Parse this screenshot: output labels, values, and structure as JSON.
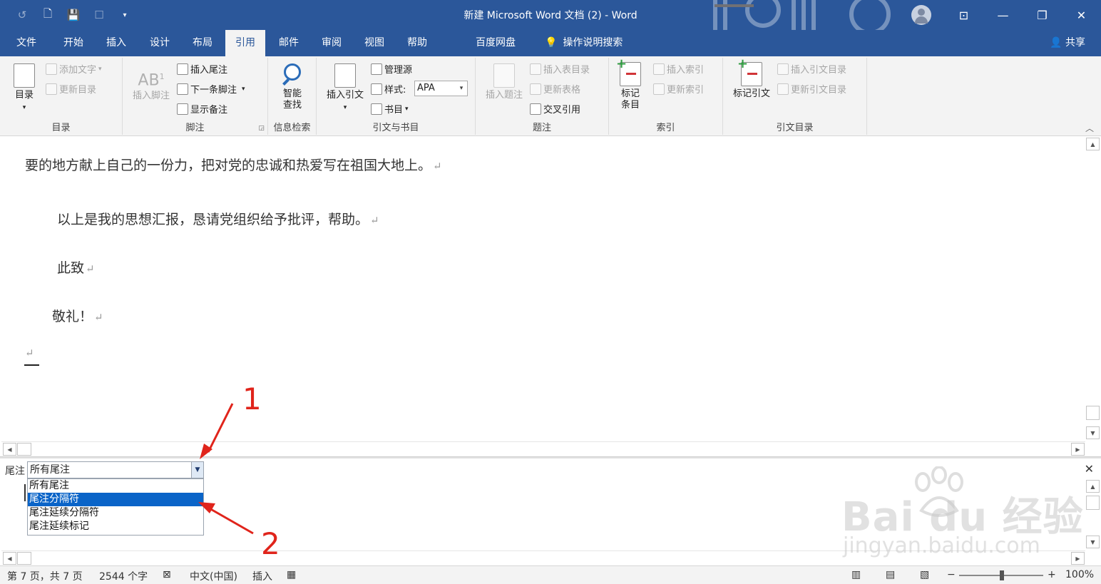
{
  "window": {
    "title": "新建 Microsoft Word 文档 (2)  -  Word",
    "controls": [
      "⊡",
      "—",
      "❐",
      "✕"
    ]
  },
  "tabs": [
    {
      "label": "文件"
    },
    {
      "label": "开始"
    },
    {
      "label": "插入"
    },
    {
      "label": "设计"
    },
    {
      "label": "布局"
    },
    {
      "label": "引用"
    },
    {
      "label": "邮件"
    },
    {
      "label": "审阅"
    },
    {
      "label": "视图"
    },
    {
      "label": "帮助"
    },
    {
      "label": "百度网盘"
    },
    {
      "label": "操作说明搜索"
    }
  ],
  "share_label": "共享",
  "ribbon": {
    "toc": {
      "big": "目录",
      "add_text": "添加文字",
      "update": "更新目录",
      "label": "目录"
    },
    "footnotes": {
      "insert_footnote": "插入脚注",
      "insert_endnote": "插入尾注",
      "next_footnote": "下一条脚注",
      "show_notes": "显示备注",
      "ab": "AB",
      "sup": "1",
      "label": "脚注"
    },
    "research": {
      "big1": "智能",
      "big2": "查找",
      "label": "信息检索"
    },
    "citations": {
      "insert_citation": "插入引文",
      "manage_sources": "管理源",
      "style_label": "样式:",
      "style_value": "APA",
      "bibliography": "书目",
      "label": "引文与书目"
    },
    "captions": {
      "insert_caption": "插入题注",
      "insert_table_of_figures": "插入表目录",
      "update_table": "更新表格",
      "cross_reference": "交叉引用",
      "label": "题注"
    },
    "index": {
      "mark1": "标记",
      "mark2": "条目",
      "insert_index": "插入索引",
      "update_index": "更新索引",
      "label": "索引"
    },
    "toa": {
      "mark_citation": "标记引文",
      "insert_toa": "插入引文目录",
      "update_toa": "更新引文目录",
      "label": "引文目录"
    }
  },
  "document": {
    "lines": [
      "要的地方献上自己的一份力，把对党的忠诚和热爱写在祖国大地上。",
      "以上是我的思想汇报，恳请党组织给予批评，帮助。",
      "此致",
      "敬礼！"
    ],
    "return_mark": "↵"
  },
  "endnote_pane": {
    "label": "尾注",
    "selected": "所有尾注",
    "options": [
      "所有尾注",
      "尾注分隔符",
      "尾注延续分隔符",
      "尾注延续标记"
    ],
    "highlighted_index": 1
  },
  "annotations": {
    "one": "1",
    "two": "2",
    "color": "#e0241b"
  },
  "watermark": {
    "brand": "Bai du 经验",
    "url": "jingyan.baidu.com"
  },
  "statusbar": {
    "page": "第 7 页，共 7 页",
    "words": "2544 个字",
    "language": "中文(中国)",
    "mode": "插入",
    "zoom": "100%",
    "zoom_level": 1.0
  },
  "colors": {
    "accent": "#2b579a",
    "selection": "#0a64c8"
  }
}
